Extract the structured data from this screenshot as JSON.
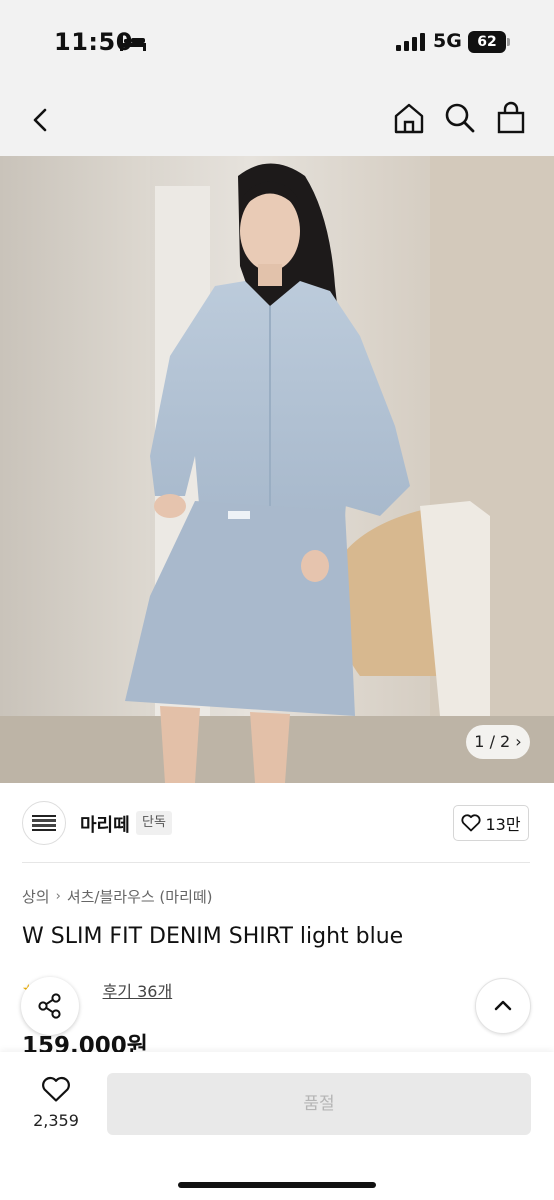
{
  "status_bar": {
    "time": "11:50",
    "network": "5G",
    "battery": "62",
    "icons": [
      "bed-icon",
      "signal-bars-icon",
      "battery-icon"
    ]
  },
  "nav": {
    "icons": [
      "chevron-left-icon",
      "home-icon",
      "search-icon",
      "shopping-bag-icon"
    ]
  },
  "gallery": {
    "pager": "1 / 2 ›",
    "current": 1,
    "total": 2
  },
  "brand": {
    "logo_text": "&#9638;&#9638;&#9638;",
    "name": "마리떼",
    "tag": "단독",
    "likes": "13만"
  },
  "product": {
    "breadcrumb": [
      "상의",
      "셔츠/블라우스 (마리떼)"
    ],
    "breadcrumb_separator": "›",
    "title": "W SLIM FIT DENIM SHIRT light blue",
    "stars": "★",
    "review_link": "후기 36개",
    "price": "159,000원"
  },
  "bottom_bar": {
    "wish_count": "2,359",
    "buy_label": "품절"
  },
  "colors": {
    "accent_star": "#f0b000",
    "disabled_button": "#e9e9e9",
    "disabled_text": "#b5b5b5"
  }
}
